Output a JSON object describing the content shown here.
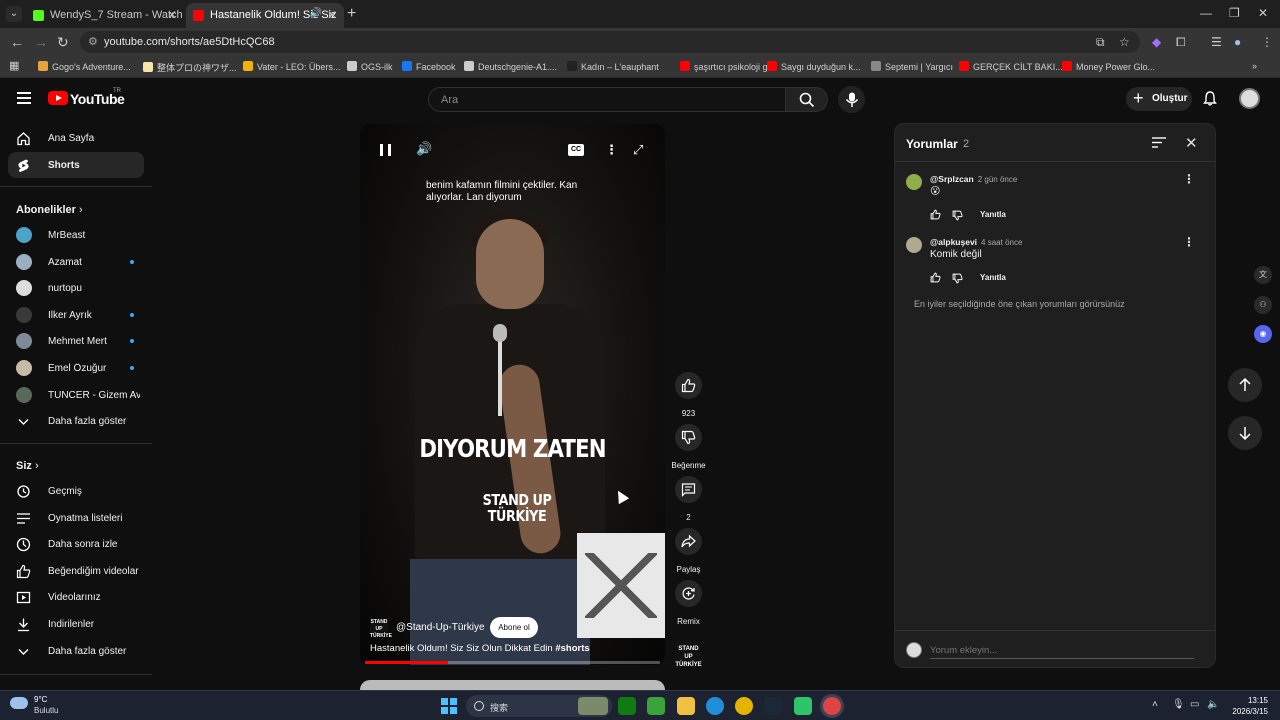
{
  "browser": {
    "tabs": [
      {
        "title": "WendyS_7 Stream - Watch Li",
        "favicon_color": "#53fc18",
        "active": false
      },
      {
        "title": "Hastanelik Oldum! Siz Siz",
        "favicon_color": "#ff0000",
        "active": true
      }
    ],
    "url": "youtube.com/shorts/ae5DtHcQC68",
    "bookmarks": [
      {
        "label": "Gogo's Adventure...",
        "color": "#e8a33d"
      },
      {
        "label": "整体プロの神ワザ...",
        "color": "#f5e6a8"
      },
      {
        "label": "Vater - LEO: Übers...",
        "color": "#f0b400"
      },
      {
        "label": "OGS-ilk",
        "color": "#cccccc"
      },
      {
        "label": "Facebook",
        "color": "#1877f2"
      },
      {
        "label": "Deutschgenie-A1....",
        "color": "#cccccc"
      },
      {
        "label": "Kadın – L'eauphant",
        "color": "#222222"
      },
      {
        "label": "şaşırtıcı psikoloji g...",
        "color": "#ff0000"
      },
      {
        "label": "Saygı duyduğun k...",
        "color": "#ff0000"
      },
      {
        "label": "Septemi | Yargıcı",
        "color": "#888888"
      },
      {
        "label": "GERÇEK CİLT BAKI...",
        "color": "#ff0000"
      },
      {
        "label": "Money Power Glo...",
        "color": "#ff0000"
      }
    ]
  },
  "header": {
    "logo_text": "YouTube",
    "logo_region": "TR",
    "search_placeholder": "Ara",
    "create_label": "Oluştur"
  },
  "sidebar": {
    "main": [
      {
        "label": "Ana Sayfa",
        "icon": "home-icon",
        "active": false
      },
      {
        "label": "Shorts",
        "icon": "shorts-icon",
        "active": true
      }
    ],
    "subscriptions_title": "Abonelikler",
    "subscriptions": [
      {
        "label": "MrBeast",
        "color": "#4aa3c8",
        "new": false
      },
      {
        "label": "Azamat",
        "color": "#9ab0c0",
        "new": true
      },
      {
        "label": "nurtopu",
        "color": "#dddddd",
        "new": false
      },
      {
        "label": "İlker Ayrık",
        "color": "#3a3a3a",
        "new": true
      },
      {
        "label": "Mehmet Mert",
        "color": "#7d8a96",
        "new": true
      },
      {
        "label": "Emel Özuğur",
        "color": "#c8b9a8",
        "new": true
      },
      {
        "label": "TUNCER - Gizem Av...",
        "color": "#5a6a5a",
        "new": false
      }
    ],
    "show_more_subs": "Daha fazla göster",
    "you_title": "Siz",
    "you_items": [
      {
        "label": "Geçmiş",
        "icon": "history-icon"
      },
      {
        "label": "Oynatma listeleri",
        "icon": "playlists-icon"
      },
      {
        "label": "Daha sonra izle",
        "icon": "watch-later-icon"
      },
      {
        "label": "Beğendiğim videolar",
        "icon": "liked-icon"
      },
      {
        "label": "Videolarınız",
        "icon": "your-videos-icon"
      },
      {
        "label": "İndirilenler",
        "icon": "download-icon"
      }
    ],
    "show_more_you": "Daha fazla göster"
  },
  "player": {
    "subtitle_text": "benim kafamın filmini çektiler. Kan alıyorlar. Lan diyorum",
    "caption_text": "DIYORUM ZATEN",
    "watermark_line1": "STAND UP",
    "watermark_line2": "TÜRKİYE",
    "channel_logo_text": "STAND UP TÜRKİYE",
    "channel_handle": "@Stand-Up-Türkiye",
    "subscribe_label": "Abone ol",
    "video_title": "Hastanelik Oldum! Siz Siz Olun Dikkat Edin",
    "video_hashtag": "#shorts",
    "progress": 0.28
  },
  "actions": {
    "like_count": "923",
    "dislike_label": "Beğenme",
    "comment_count": "2",
    "share_label": "Paylaş",
    "remix_label": "Remix"
  },
  "comments": {
    "title": "Yorumlar",
    "count": "2",
    "items": [
      {
        "user": "@Srplzcan",
        "time": "2 gün önce",
        "text": "😮",
        "reply_label": "Yanıtla",
        "avatar_color": "#8fae4a"
      },
      {
        "user": "@alpkuşevi",
        "time": "4 saat önce",
        "text": "Komik değil",
        "reply_label": "Yanıtla",
        "avatar_color": "#b0a890"
      }
    ],
    "note": "En iyiler seçildiğinde öne çıkan yorumları görürsünüz",
    "input_placeholder": "Yorum ekleyin..."
  },
  "taskbar": {
    "temp": "9°C",
    "condition": "Bulutlu",
    "search_label": "搜索",
    "time": "13:15",
    "date": "2026/3/15"
  }
}
